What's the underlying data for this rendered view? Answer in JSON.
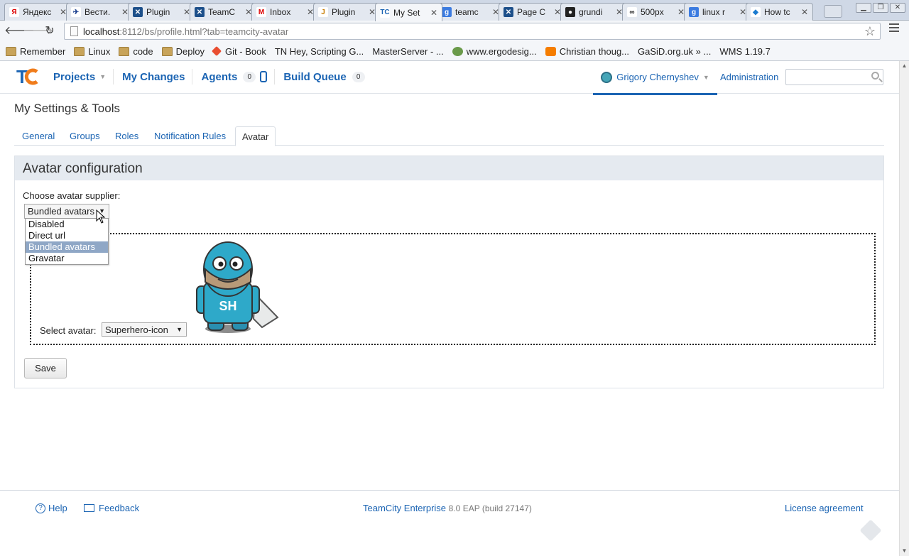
{
  "browser": {
    "tabs": [
      {
        "title": "Яндекс",
        "fav_color": "#ffffff",
        "fav_text": "Я",
        "fav_text_color": "#d00"
      },
      {
        "title": "Вести.",
        "fav_color": "#ffffff",
        "fav_text": "✈",
        "fav_text_color": "#1a3f8f"
      },
      {
        "title": "Plugin",
        "fav_color": "#1c4f8a",
        "fav_text": "✕",
        "fav_text_color": "#fff"
      },
      {
        "title": "TeamC",
        "fav_color": "#1c4f8a",
        "fav_text": "✕",
        "fav_text_color": "#fff"
      },
      {
        "title": "Inbox",
        "fav_color": "#ffffff",
        "fav_text": "M",
        "fav_text_color": "#d00"
      },
      {
        "title": "Plugin",
        "fav_color": "#ffffff",
        "fav_text": "J",
        "fav_text_color": "#c77b00"
      },
      {
        "title": "My Set",
        "fav_color": "#ffffff",
        "fav_text": "TC",
        "fav_text_color": "#1b64b3"
      },
      {
        "title": "teamc",
        "fav_color": "#3b7be0",
        "fav_text": "g",
        "fav_text_color": "#fff"
      },
      {
        "title": "Page C",
        "fav_color": "#1c4f8a",
        "fav_text": "✕",
        "fav_text_color": "#fff"
      },
      {
        "title": "grundi",
        "fav_color": "#222222",
        "fav_text": "●",
        "fav_text_color": "#fff"
      },
      {
        "title": "500px",
        "fav_color": "#ffffff",
        "fav_text": "∞",
        "fav_text_color": "#111"
      },
      {
        "title": "linux r",
        "fav_color": "#3b7be0",
        "fav_text": "g",
        "fav_text_color": "#fff"
      },
      {
        "title": "How tc",
        "fav_color": "#ffffff",
        "fav_text": "◆",
        "fav_text_color": "#1b7bd0"
      }
    ],
    "url_host": "localhost",
    "url_rest": ":8112/bs/profile.html?tab=teamcity-avatar",
    "bookmarks": [
      {
        "label": "Remember",
        "icon": "folder"
      },
      {
        "label": "Linux",
        "icon": "folder"
      },
      {
        "label": "code",
        "icon": "folder"
      },
      {
        "label": "Deploy",
        "icon": "folder"
      },
      {
        "label": "Git - Book",
        "icon": "git"
      },
      {
        "label": "TN Hey, Scripting G...",
        "icon": "none"
      },
      {
        "label": "MasterServer - ...",
        "icon": "page"
      },
      {
        "label": "www.ergodesig...",
        "icon": "globe"
      },
      {
        "label": "Christian thoug...",
        "icon": "blog"
      },
      {
        "label": "GaSiD.org.uk » ...",
        "icon": "page"
      },
      {
        "label": "WMS 1.19.7",
        "icon": "page"
      }
    ]
  },
  "header": {
    "projects": "Projects",
    "my_changes": "My Changes",
    "agents": "Agents",
    "agents_count": "0",
    "build_queue": "Build Queue",
    "build_queue_count": "0",
    "user": "Grigory Chernyshev",
    "administration": "Administration",
    "search_value": ""
  },
  "page": {
    "title": "My Settings & Tools",
    "tabs": [
      "General",
      "Groups",
      "Roles",
      "Notification Rules",
      "Avatar"
    ],
    "active_tab": "Avatar"
  },
  "panel": {
    "heading": "Avatar configuration",
    "choose_label": "Choose avatar supplier:",
    "supplier_selected": "Bundled avatars",
    "supplier_options": [
      "Disabled",
      "Direct url",
      "Bundled avatars",
      "Gravatar"
    ],
    "select_avatar_label": "Select avatar:",
    "avatar_selected": "Superhero-icon",
    "avatar_initials": "SH",
    "save_label": "Save"
  },
  "footer": {
    "help": "Help",
    "feedback": "Feedback",
    "product": "TeamCity Enterprise",
    "version": "8.0 EAP (build 27147)",
    "license": "License agreement"
  },
  "colors": {
    "link": "#1b64b3",
    "panel_head": "#e5eaf0",
    "selected_option": "#8fa7c6",
    "hero_body": "#2ea9c9"
  }
}
